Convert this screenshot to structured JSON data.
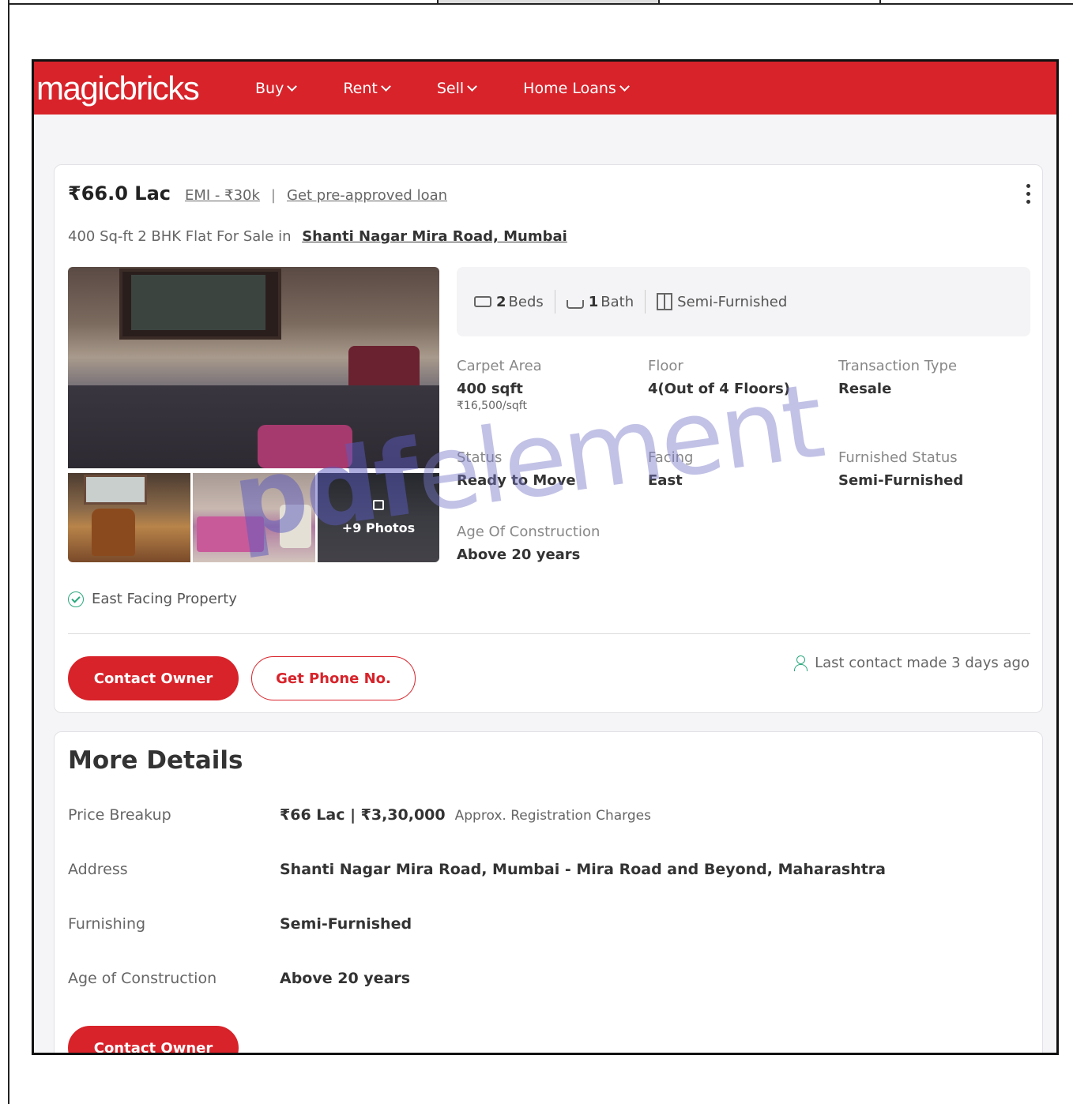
{
  "nav": {
    "logo": "magicbricks",
    "items": [
      {
        "label": "Buy"
      },
      {
        "label": "Rent"
      },
      {
        "label": "Sell"
      },
      {
        "label": "Home Loans"
      }
    ]
  },
  "listing": {
    "price": "₹66.0 Lac",
    "emi": "EMI - ₹30k",
    "separator": "|",
    "loan_link": "Get pre-approved loan",
    "subtitle": "400 Sq-ft 2 BHK Flat For Sale in",
    "location": "Shanti Nagar Mira Road, Mumbai",
    "more_photos": "+9 Photos",
    "summary": {
      "beds_count": "2",
      "beds_label": "Beds",
      "bath_count": "1",
      "bath_label": "Bath",
      "furnishing": "Semi-Furnished"
    },
    "details": {
      "carpet_area_label": "Carpet Area",
      "carpet_area_value": "400 sqft",
      "carpet_area_rate": "₹16,500/sqft",
      "floor_label": "Floor",
      "floor_value": "4(Out of 4 Floors)",
      "transaction_label": "Transaction Type",
      "transaction_value": "Resale",
      "status_label": "Status",
      "status_value": "Ready to Move",
      "facing_label": "Facing",
      "facing_value": "East",
      "furnished_label": "Furnished Status",
      "furnished_value": "Semi-Furnished",
      "age_label": "Age Of Construction",
      "age_value": "Above 20 years"
    },
    "feature": "East Facing Property",
    "contact_button": "Contact Owner",
    "phone_button": "Get Phone No.",
    "last_contact": "Last contact made 3 days ago"
  },
  "more_details": {
    "title": "More Details",
    "rows": [
      {
        "label": "Price Breakup",
        "value": "₹66 Lac | ₹3,30,000",
        "note": "Approx. Registration Charges"
      },
      {
        "label": "Address",
        "value": "Shanti Nagar Mira Road, Mumbai - Mira Road and Beyond, Maharashtra"
      },
      {
        "label": "Furnishing",
        "value": "Semi-Furnished"
      },
      {
        "label": "Age of Construction",
        "value": "Above 20 years"
      }
    ],
    "contact_button": "Contact Owner"
  },
  "watermark": {
    "part1": "pdf",
    "part2": "element"
  },
  "colors": {
    "brand_red": "#d8232a",
    "success_green": "#2aa87e"
  }
}
